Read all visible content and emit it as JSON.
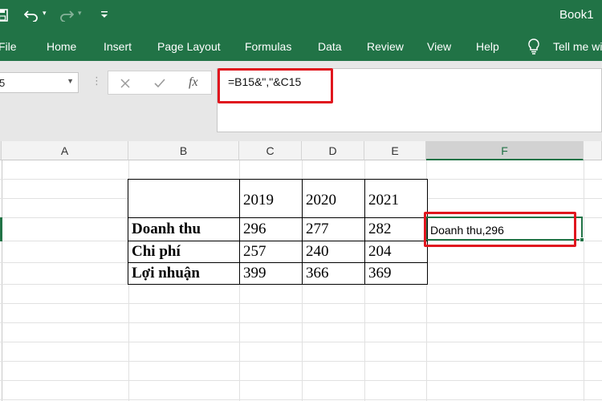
{
  "titlebar": {
    "book_title": "Book1",
    "save_icon": "save-icon",
    "undo_icon": "undo-icon",
    "redo_icon": "redo-icon",
    "customize_icon": "customize-qat-icon"
  },
  "ribbon": {
    "tabs": [
      "File",
      "Home",
      "Insert",
      "Page Layout",
      "Formulas",
      "Data",
      "Review",
      "View",
      "Help"
    ],
    "tell_me": "Tell me wi",
    "tell_me_icon": "lightbulb-icon"
  },
  "formula_bar": {
    "name_box": "5",
    "formula": "=B15&\",\"&C15",
    "cancel_icon": "cancel-icon",
    "enter_icon": "check-icon",
    "fx_label": "fx"
  },
  "columns": [
    "A",
    "B",
    "C",
    "D",
    "E",
    "F"
  ],
  "selected_column": "F",
  "table": {
    "header": [
      "",
      "2019",
      "2020",
      "2021"
    ],
    "rows": [
      [
        "Doanh thu",
        "296",
        "277",
        "282"
      ],
      [
        "Chi phí",
        "257",
        "240",
        "204"
      ],
      [
        "Lợi nhuận",
        "399",
        "366",
        "369"
      ]
    ]
  },
  "result_cell": "Doanh thu,296",
  "accent_color": "#217346",
  "highlight_color": "#e0161e"
}
